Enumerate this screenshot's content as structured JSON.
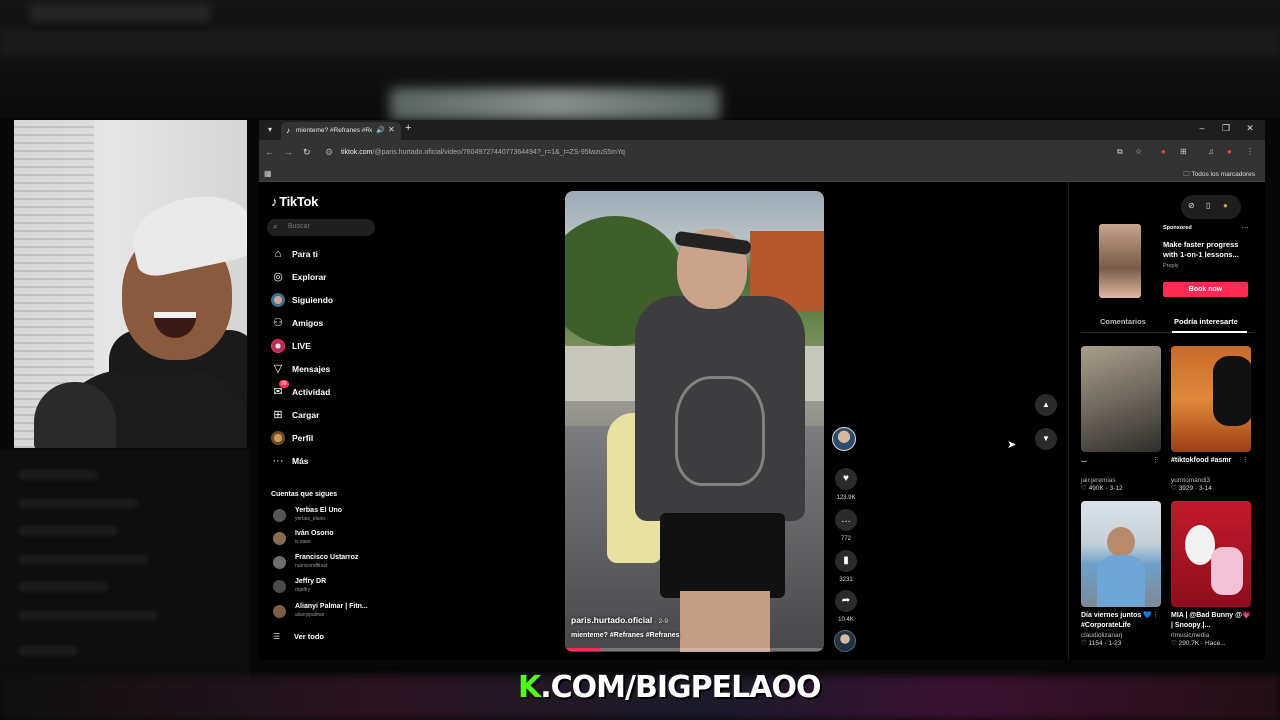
{
  "browser": {
    "tab_title": "mienteme? #Refranes #Ref",
    "url_domain": "tiktok.com",
    "url_path": "/@paris.hurtado.oficial/video/7604972744077364494?_r=1&_t=ZS-95lwzuS5mYq",
    "bookmarks_label": "Todos los marcadores"
  },
  "sidebar": {
    "logo": "TikTok",
    "search_placeholder": "Buscar",
    "nav": [
      {
        "label": "Para ti",
        "icon": "home-icon"
      },
      {
        "label": "Explorar",
        "icon": "compass-icon"
      },
      {
        "label": "Siguiendo",
        "icon": "following-avatar-icon"
      },
      {
        "label": "Amigos",
        "icon": "friends-icon"
      },
      {
        "label": "LIVE",
        "icon": "live-icon"
      },
      {
        "label": "Mensajes",
        "icon": "send-icon"
      },
      {
        "label": "Actividad",
        "icon": "activity-icon",
        "badge": "99"
      },
      {
        "label": "Cargar",
        "icon": "upload-icon"
      },
      {
        "label": "Perfil",
        "icon": "profile-avatar-icon"
      },
      {
        "label": "Más",
        "icon": "more-icon"
      }
    ],
    "following_title": "Cuentas que sigues",
    "following": [
      {
        "name": "Yerbas El Uno",
        "user": "yerbas_eluno"
      },
      {
        "name": "Iván Osorio",
        "user": "iv.vaan"
      },
      {
        "name": "Francisco Ustarroz",
        "user": "nutriciondfitust"
      },
      {
        "name": "Jeffry DR",
        "user": "drjeffry"
      },
      {
        "name": "Alianyi Palmar | Fitn...",
        "user": "alianyipalmar"
      }
    ],
    "see_all": "Ver todo"
  },
  "video": {
    "username": "paris.hurtado.oficial",
    "date": "· 2-9",
    "caption": "mienteme? #Refranes #Refranes",
    "progress": 0.14
  },
  "actions": {
    "likes": "123.9K",
    "comments": "772",
    "saves": "3231",
    "shares": "10.4K"
  },
  "right_panel": {
    "ad": {
      "sponsored": "Sponsored",
      "text": "Make faster progress with 1-on-1 lessons...",
      "brand": "Preply",
      "cta": "Book now"
    },
    "tabs": [
      "Comentarios",
      "Podría interesarte"
    ],
    "cards": [
      {
        "title": "...",
        "user": "jair.jeremias",
        "stats": "♡ 490K · 3-12"
      },
      {
        "title": "#tiktokfood #asmr",
        "user": "yumtomandi3",
        "stats": "♡ 3929 · 3-14"
      },
      {
        "title": "Día viernes juntos 💙 #CorporateLife",
        "user": "claudiolizanarj",
        "stats": "♡ 1154 · 1-23"
      },
      {
        "title": "MIA | @Bad Bunny @💗 | Snoopy |...",
        "user": "rlmusicmedia",
        "stats": "♡ 290.7K · Hace..."
      }
    ]
  },
  "overlay": {
    "k": "K",
    "text": ".COM/BIGPELAOO"
  },
  "colors": {
    "accent": "#fe2c55",
    "kick_green": "#53fc18"
  }
}
